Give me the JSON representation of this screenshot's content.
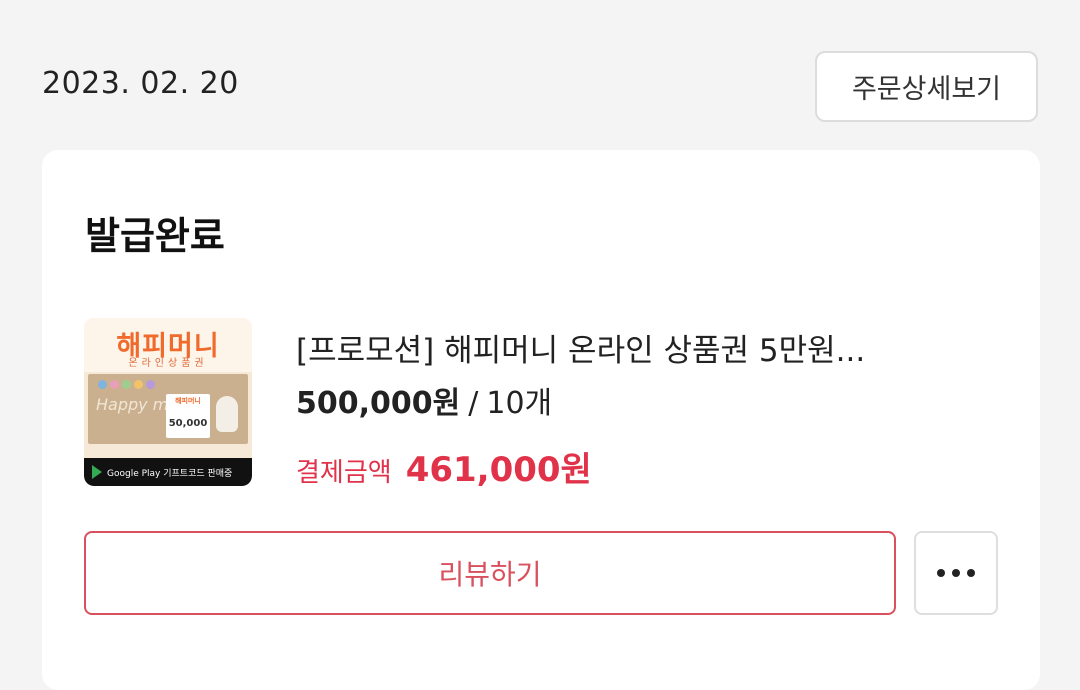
{
  "order": {
    "date": "2023. 02. 20",
    "detail_button_label": "주문상세보기"
  },
  "card": {
    "status": "발급완료",
    "product": {
      "name": "[프로모션] 해피머니 온라인 상품권 5만원...",
      "price": "500,000원",
      "separator": "/",
      "quantity": "10개",
      "payment_label": "결제금액",
      "payment_amount": "461,000원",
      "thumbnail": {
        "brand": "해피머니",
        "subtitle": "온라인상품권",
        "happy_text": "Happy money",
        "card_title": "해피머니",
        "card_amount": "50,000",
        "store_badge": "Google Play 기프트코드 판매중",
        "brand_color": "#f06a2b"
      }
    },
    "review_button_label": "리뷰하기",
    "more_icon": "more-horizontal-icon"
  },
  "colors": {
    "accent": "#e0334a",
    "review_border": "#d9505f",
    "background": "#f4f4f4"
  }
}
